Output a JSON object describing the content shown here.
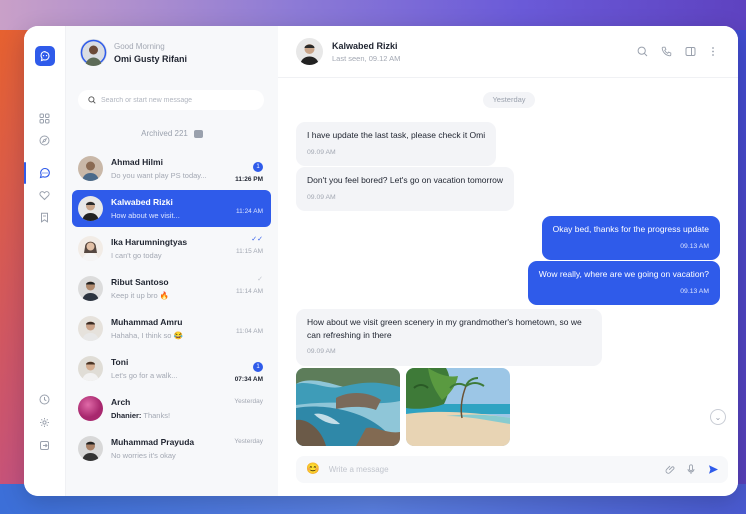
{
  "me": {
    "greeting": "Good Morning",
    "name": "Omi Gusty Rifani"
  },
  "search": {
    "placeholder": "Search or start new message"
  },
  "archived": {
    "label": "Archived 221"
  },
  "conversations": [
    {
      "name": "Ahmad Hilmi",
      "preview": "Do you want play PS today...",
      "time": "11:26 PM",
      "badge": "1",
      "time_bold": true
    },
    {
      "name": "Kalwabed Rizki",
      "preview": "How about we visit...",
      "time": "11:24 AM",
      "active": true
    },
    {
      "name": "Ika Harumningtyas",
      "preview": "I can't go today",
      "time": "11:15 AM",
      "status": "read"
    },
    {
      "name": "Ribut Santoso",
      "preview": "Keep it up bro 🔥",
      "time": "11:14 AM",
      "status": "delivered"
    },
    {
      "name": "Muhammad Amru",
      "preview": "Hahaha, I think so 😂",
      "time": "11:04 AM"
    },
    {
      "name": "Toni",
      "preview": "Let's go for a walk...",
      "time": "07:34 AM",
      "badge": "1",
      "time_bold": true
    },
    {
      "name": "Arch",
      "preview_sender": "Dhanier:",
      "preview": "Thanks!",
      "time": "Yesterday"
    },
    {
      "name": "Muhammad Prayuda",
      "preview": "No worries it's okay",
      "time": "Yesterday"
    }
  ],
  "chat": {
    "peer_name": "Kalwabed Rizki",
    "peer_status": "Last seen, 09.12 AM",
    "day_label": "Yesterday",
    "messages": [
      {
        "dir": "in",
        "text": "I have update the last task, please check it Omi",
        "time": "09.09 AM"
      },
      {
        "dir": "in",
        "text": "Don't you feel bored? Let's go on vacation tomorrow",
        "time": "09.09 AM"
      },
      {
        "dir": "out",
        "text": "Okay bed, thanks for the progress update",
        "time": "09.13 AM"
      },
      {
        "dir": "out",
        "text": "Wow really, where are we going on vacation?",
        "time": "09.13 AM"
      },
      {
        "dir": "in",
        "text": "How about we visit green scenery in my grandmother's hometown, so we can refreshing in there",
        "time": "09.09 AM"
      }
    ],
    "composer_placeholder": "Write a message"
  },
  "colors": {
    "accent": "#2f5bea",
    "panel": "#f7f8fa",
    "bubble_in": "#f3f4f7"
  },
  "icons": {
    "rail": [
      "grid-icon",
      "compass-icon",
      "chat-icon",
      "heart-icon",
      "bookmark-icon",
      "clock-icon",
      "settings-icon",
      "logout-icon"
    ],
    "header": [
      "search-icon",
      "phone-icon",
      "sidebar-toggle-icon",
      "more-icon"
    ],
    "composer": [
      "emoji-icon",
      "attach-icon",
      "microphone-icon",
      "send-icon"
    ]
  }
}
